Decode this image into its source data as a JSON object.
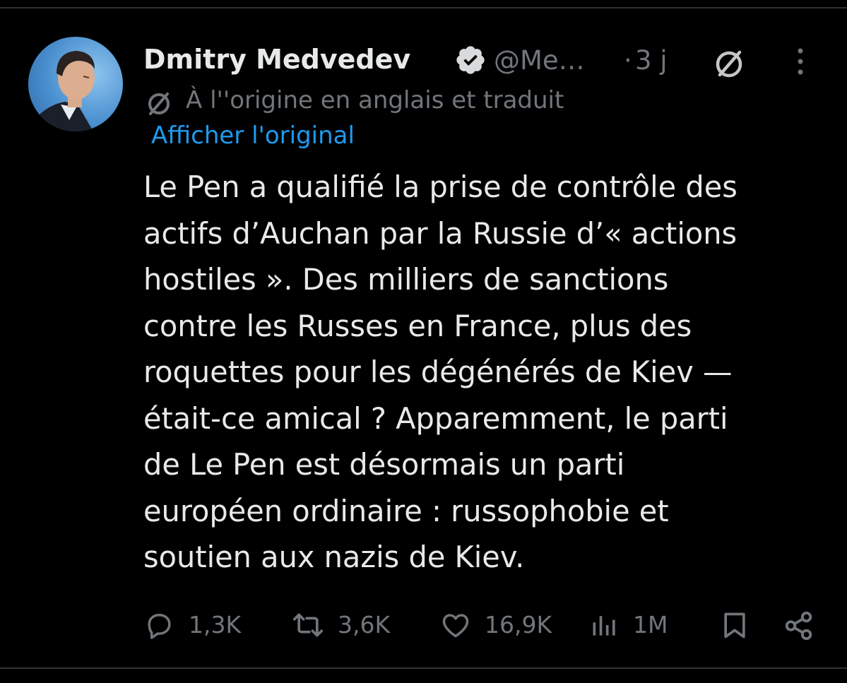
{
  "tweet": {
    "author_name": "Dmitry Medvedev",
    "handle": "@Me…",
    "separator": "·",
    "timestamp": "3 j",
    "translation_notice": "À l''origine en anglais et traduit",
    "show_original_label": "Afficher l'original",
    "text_lines": [
      "Le Pen a qualifié la prise de contrôle des",
      "actifs d’Auchan par la Russie d’« actions",
      "hostiles ». Des milliers de sanctions",
      "contre les Russes en France, plus des",
      "roquettes pour les dégénérés de Kiev —",
      "était-ce amical ? Apparemment, le parti",
      "de Le Pen est désormais un parti",
      "européen ordinaire : russophobie et",
      "soutien aux nazis de Kiev."
    ]
  },
  "metrics": {
    "replies": "1,3K",
    "reposts": "3,6K",
    "likes": "16,9K",
    "views": "1M"
  },
  "icons": {
    "verified": "verified-badge-icon",
    "translate": "translate-icon",
    "more": "more-options-icon",
    "reply": "reply-icon",
    "repost": "repost-icon",
    "like": "like-icon",
    "views": "views-icon",
    "bookmark": "bookmark-icon",
    "share": "share-icon"
  },
  "colors": {
    "background": "#000000",
    "text": "#e7e9ea",
    "muted": "#71767b",
    "link": "#1d9bf0",
    "divider": "#2f3336"
  }
}
